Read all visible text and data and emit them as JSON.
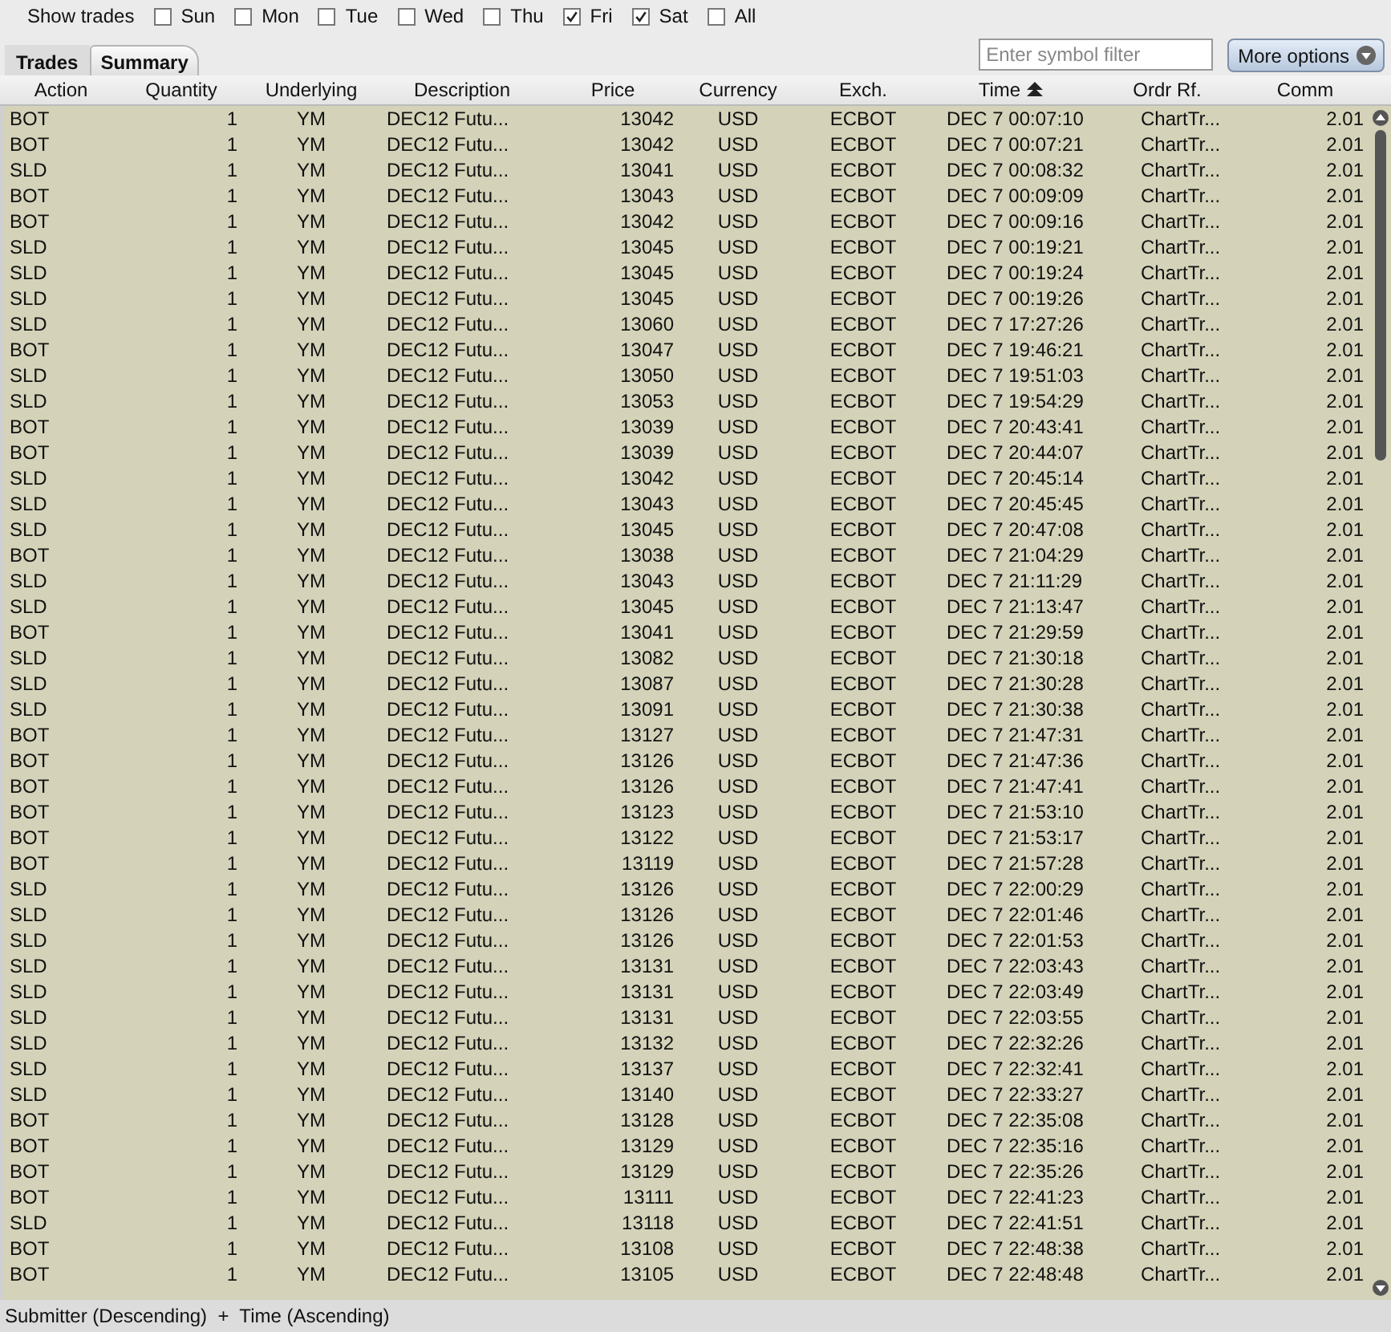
{
  "filter_bar": {
    "label": "Show trades",
    "days": [
      {
        "label": "Sun",
        "checked": false
      },
      {
        "label": "Mon",
        "checked": false
      },
      {
        "label": "Tue",
        "checked": false
      },
      {
        "label": "Wed",
        "checked": false
      },
      {
        "label": "Thu",
        "checked": false
      },
      {
        "label": "Fri",
        "checked": true
      },
      {
        "label": "Sat",
        "checked": true
      },
      {
        "label": "All",
        "checked": false
      }
    ]
  },
  "tabs": [
    {
      "label": "Trades",
      "selected": false
    },
    {
      "label": "Summary",
      "selected": true
    }
  ],
  "search": {
    "placeholder": "Enter symbol filter"
  },
  "more_options_button": {
    "label": "More options"
  },
  "table": {
    "columns": [
      {
        "label": "Action",
        "sorted": false
      },
      {
        "label": "Quantity",
        "sorted": false
      },
      {
        "label": "Underlying",
        "sorted": false
      },
      {
        "label": "Description",
        "sorted": false
      },
      {
        "label": "Price",
        "sorted": false
      },
      {
        "label": "Currency",
        "sorted": false
      },
      {
        "label": "Exch.",
        "sorted": false
      },
      {
        "label": "Time",
        "sorted": true
      },
      {
        "label": "Ordr Rf.",
        "sorted": false
      },
      {
        "label": "Comm",
        "sorted": false
      }
    ],
    "rows": [
      [
        "BOT",
        "1",
        "YM",
        "DEC12 Futu...",
        "13042",
        "USD",
        "ECBOT",
        "DEC 7 00:07:10",
        "ChartTr...",
        "2.01"
      ],
      [
        "BOT",
        "1",
        "YM",
        "DEC12 Futu...",
        "13042",
        "USD",
        "ECBOT",
        "DEC 7 00:07:21",
        "ChartTr...",
        "2.01"
      ],
      [
        "SLD",
        "1",
        "YM",
        "DEC12 Futu...",
        "13041",
        "USD",
        "ECBOT",
        "DEC 7 00:08:32",
        "ChartTr...",
        "2.01"
      ],
      [
        "BOT",
        "1",
        "YM",
        "DEC12 Futu...",
        "13043",
        "USD",
        "ECBOT",
        "DEC 7 00:09:09",
        "ChartTr...",
        "2.01"
      ],
      [
        "BOT",
        "1",
        "YM",
        "DEC12 Futu...",
        "13042",
        "USD",
        "ECBOT",
        "DEC 7 00:09:16",
        "ChartTr...",
        "2.01"
      ],
      [
        "SLD",
        "1",
        "YM",
        "DEC12 Futu...",
        "13045",
        "USD",
        "ECBOT",
        "DEC 7 00:19:21",
        "ChartTr...",
        "2.01"
      ],
      [
        "SLD",
        "1",
        "YM",
        "DEC12 Futu...",
        "13045",
        "USD",
        "ECBOT",
        "DEC 7 00:19:24",
        "ChartTr...",
        "2.01"
      ],
      [
        "SLD",
        "1",
        "YM",
        "DEC12 Futu...",
        "13045",
        "USD",
        "ECBOT",
        "DEC 7 00:19:26",
        "ChartTr...",
        "2.01"
      ],
      [
        "SLD",
        "1",
        "YM",
        "DEC12 Futu...",
        "13060",
        "USD",
        "ECBOT",
        "DEC 7 17:27:26",
        "ChartTr...",
        "2.01"
      ],
      [
        "BOT",
        "1",
        "YM",
        "DEC12 Futu...",
        "13047",
        "USD",
        "ECBOT",
        "DEC 7 19:46:21",
        "ChartTr...",
        "2.01"
      ],
      [
        "SLD",
        "1",
        "YM",
        "DEC12 Futu...",
        "13050",
        "USD",
        "ECBOT",
        "DEC 7 19:51:03",
        "ChartTr...",
        "2.01"
      ],
      [
        "SLD",
        "1",
        "YM",
        "DEC12 Futu...",
        "13053",
        "USD",
        "ECBOT",
        "DEC 7 19:54:29",
        "ChartTr...",
        "2.01"
      ],
      [
        "BOT",
        "1",
        "YM",
        "DEC12 Futu...",
        "13039",
        "USD",
        "ECBOT",
        "DEC 7 20:43:41",
        "ChartTr...",
        "2.01"
      ],
      [
        "BOT",
        "1",
        "YM",
        "DEC12 Futu...",
        "13039",
        "USD",
        "ECBOT",
        "DEC 7 20:44:07",
        "ChartTr...",
        "2.01"
      ],
      [
        "SLD",
        "1",
        "YM",
        "DEC12 Futu...",
        "13042",
        "USD",
        "ECBOT",
        "DEC 7 20:45:14",
        "ChartTr...",
        "2.01"
      ],
      [
        "SLD",
        "1",
        "YM",
        "DEC12 Futu...",
        "13043",
        "USD",
        "ECBOT",
        "DEC 7 20:45:45",
        "ChartTr...",
        "2.01"
      ],
      [
        "SLD",
        "1",
        "YM",
        "DEC12 Futu...",
        "13045",
        "USD",
        "ECBOT",
        "DEC 7 20:47:08",
        "ChartTr...",
        "2.01"
      ],
      [
        "BOT",
        "1",
        "YM",
        "DEC12 Futu...",
        "13038",
        "USD",
        "ECBOT",
        "DEC 7 21:04:29",
        "ChartTr...",
        "2.01"
      ],
      [
        "SLD",
        "1",
        "YM",
        "DEC12 Futu...",
        "13043",
        "USD",
        "ECBOT",
        "DEC 7 21:11:29",
        "ChartTr...",
        "2.01"
      ],
      [
        "SLD",
        "1",
        "YM",
        "DEC12 Futu...",
        "13045",
        "USD",
        "ECBOT",
        "DEC 7 21:13:47",
        "ChartTr...",
        "2.01"
      ],
      [
        "BOT",
        "1",
        "YM",
        "DEC12 Futu...",
        "13041",
        "USD",
        "ECBOT",
        "DEC 7 21:29:59",
        "ChartTr...",
        "2.01"
      ],
      [
        "SLD",
        "1",
        "YM",
        "DEC12 Futu...",
        "13082",
        "USD",
        "ECBOT",
        "DEC 7 21:30:18",
        "ChartTr...",
        "2.01"
      ],
      [
        "SLD",
        "1",
        "YM",
        "DEC12 Futu...",
        "13087",
        "USD",
        "ECBOT",
        "DEC 7 21:30:28",
        "ChartTr...",
        "2.01"
      ],
      [
        "SLD",
        "1",
        "YM",
        "DEC12 Futu...",
        "13091",
        "USD",
        "ECBOT",
        "DEC 7 21:30:38",
        "ChartTr...",
        "2.01"
      ],
      [
        "BOT",
        "1",
        "YM",
        "DEC12 Futu...",
        "13127",
        "USD",
        "ECBOT",
        "DEC 7 21:47:31",
        "ChartTr...",
        "2.01"
      ],
      [
        "BOT",
        "1",
        "YM",
        "DEC12 Futu...",
        "13126",
        "USD",
        "ECBOT",
        "DEC 7 21:47:36",
        "ChartTr...",
        "2.01"
      ],
      [
        "BOT",
        "1",
        "YM",
        "DEC12 Futu...",
        "13126",
        "USD",
        "ECBOT",
        "DEC 7 21:47:41",
        "ChartTr...",
        "2.01"
      ],
      [
        "BOT",
        "1",
        "YM",
        "DEC12 Futu...",
        "13123",
        "USD",
        "ECBOT",
        "DEC 7 21:53:10",
        "ChartTr...",
        "2.01"
      ],
      [
        "BOT",
        "1",
        "YM",
        "DEC12 Futu...",
        "13122",
        "USD",
        "ECBOT",
        "DEC 7 21:53:17",
        "ChartTr...",
        "2.01"
      ],
      [
        "BOT",
        "1",
        "YM",
        "DEC12 Futu...",
        "13119",
        "USD",
        "ECBOT",
        "DEC 7 21:57:28",
        "ChartTr...",
        "2.01"
      ],
      [
        "SLD",
        "1",
        "YM",
        "DEC12 Futu...",
        "13126",
        "USD",
        "ECBOT",
        "DEC 7 22:00:29",
        "ChartTr...",
        "2.01"
      ],
      [
        "SLD",
        "1",
        "YM",
        "DEC12 Futu...",
        "13126",
        "USD",
        "ECBOT",
        "DEC 7 22:01:46",
        "ChartTr...",
        "2.01"
      ],
      [
        "SLD",
        "1",
        "YM",
        "DEC12 Futu...",
        "13126",
        "USD",
        "ECBOT",
        "DEC 7 22:01:53",
        "ChartTr...",
        "2.01"
      ],
      [
        "SLD",
        "1",
        "YM",
        "DEC12 Futu...",
        "13131",
        "USD",
        "ECBOT",
        "DEC 7 22:03:43",
        "ChartTr...",
        "2.01"
      ],
      [
        "SLD",
        "1",
        "YM",
        "DEC12 Futu...",
        "13131",
        "USD",
        "ECBOT",
        "DEC 7 22:03:49",
        "ChartTr...",
        "2.01"
      ],
      [
        "SLD",
        "1",
        "YM",
        "DEC12 Futu...",
        "13131",
        "USD",
        "ECBOT",
        "DEC 7 22:03:55",
        "ChartTr...",
        "2.01"
      ],
      [
        "SLD",
        "1",
        "YM",
        "DEC12 Futu...",
        "13132",
        "USD",
        "ECBOT",
        "DEC 7 22:32:26",
        "ChartTr...",
        "2.01"
      ],
      [
        "SLD",
        "1",
        "YM",
        "DEC12 Futu...",
        "13137",
        "USD",
        "ECBOT",
        "DEC 7 22:32:41",
        "ChartTr...",
        "2.01"
      ],
      [
        "SLD",
        "1",
        "YM",
        "DEC12 Futu...",
        "13140",
        "USD",
        "ECBOT",
        "DEC 7 22:33:27",
        "ChartTr...",
        "2.01"
      ],
      [
        "BOT",
        "1",
        "YM",
        "DEC12 Futu...",
        "13128",
        "USD",
        "ECBOT",
        "DEC 7 22:35:08",
        "ChartTr...",
        "2.01"
      ],
      [
        "BOT",
        "1",
        "YM",
        "DEC12 Futu...",
        "13129",
        "USD",
        "ECBOT",
        "DEC 7 22:35:16",
        "ChartTr...",
        "2.01"
      ],
      [
        "BOT",
        "1",
        "YM",
        "DEC12 Futu...",
        "13129",
        "USD",
        "ECBOT",
        "DEC 7 22:35:26",
        "ChartTr...",
        "2.01"
      ],
      [
        "BOT",
        "1",
        "YM",
        "DEC12 Futu...",
        "13111",
        "USD",
        "ECBOT",
        "DEC 7 22:41:23",
        "ChartTr...",
        "2.01"
      ],
      [
        "SLD",
        "1",
        "YM",
        "DEC12 Futu...",
        "13118",
        "USD",
        "ECBOT",
        "DEC 7 22:41:51",
        "ChartTr...",
        "2.01"
      ],
      [
        "BOT",
        "1",
        "YM",
        "DEC12 Futu...",
        "13108",
        "USD",
        "ECBOT",
        "DEC 7 22:48:38",
        "ChartTr...",
        "2.01"
      ],
      [
        "BOT",
        "1",
        "YM",
        "DEC12 Futu...",
        "13105",
        "USD",
        "ECBOT",
        "DEC 7 22:48:48",
        "ChartTr...",
        "2.01"
      ]
    ]
  },
  "status_bar": {
    "text": "Submitter (Descending)  +  Time (Ascending)"
  }
}
